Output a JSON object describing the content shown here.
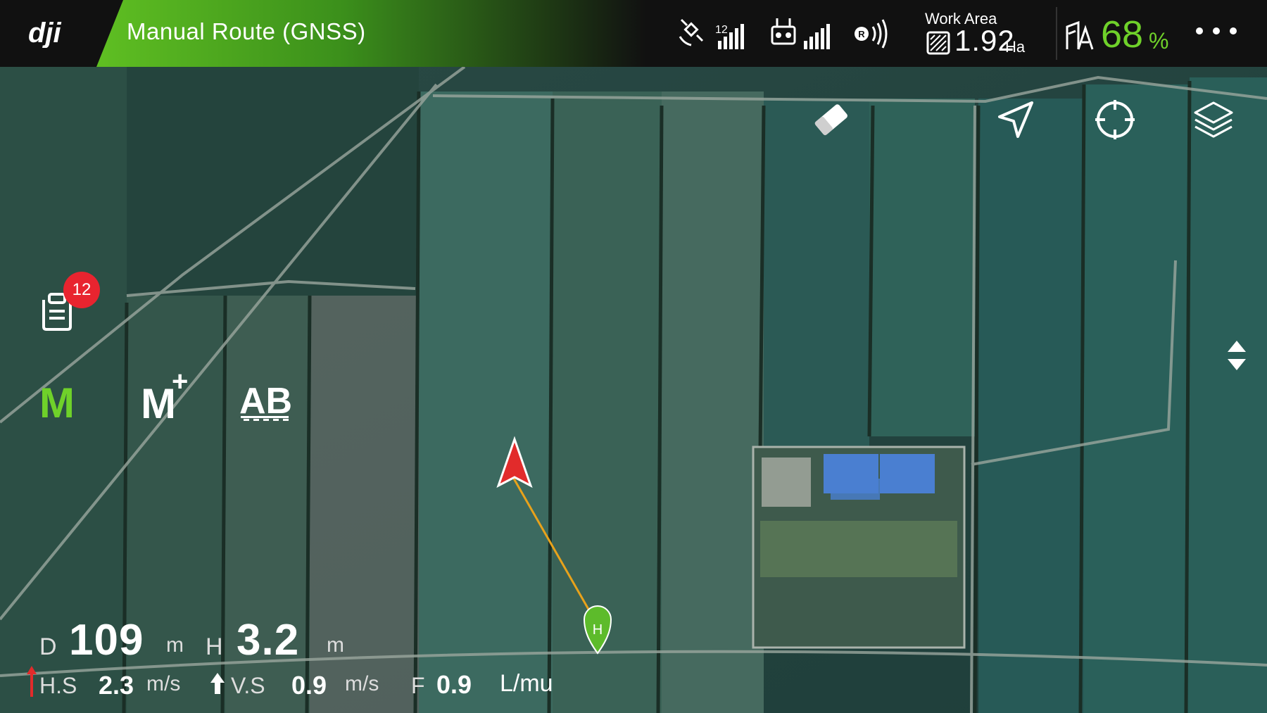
{
  "header": {
    "mode_title": "Manual Route (GNSS)",
    "gnss_count": "12",
    "work_area": {
      "label": "Work Area",
      "value": "1.92",
      "unit": "Ha"
    },
    "battery": {
      "value": "68",
      "unit": "%"
    },
    "colors": {
      "accent": "#6fd12a",
      "banner": "#5fbf22",
      "badge": "#e8242f"
    }
  },
  "left_panel": {
    "task_badge": "12",
    "modes": {
      "m": "M",
      "m_plus": "M",
      "m_plus_sup": "+",
      "ab": "AB"
    }
  },
  "map": {
    "home_point_label": "H"
  },
  "telemetry": {
    "distance": {
      "label": "D",
      "value": "109",
      "unit": "m"
    },
    "height": {
      "label": "H",
      "value": "3.2",
      "unit": "m"
    },
    "h_speed": {
      "label": "H.S",
      "value": "2.3",
      "unit": "m/s"
    },
    "v_speed": {
      "label": "V.S",
      "value": "0.9",
      "unit": "m/s"
    },
    "flow": {
      "label": "F",
      "value": "0.9",
      "unit": "L/mu"
    }
  },
  "icons": [
    "dji-logo",
    "gnss-satellite-icon",
    "rc-signal-icon",
    "rtk-icon",
    "work-area-icon",
    "battery-icon",
    "more-icon",
    "eraser-icon",
    "compass-icon",
    "locate-arrow-icon",
    "crosshair-icon",
    "layers-icon",
    "expand-toggle-icon",
    "task-list-icon",
    "aircraft-icon",
    "home-point-icon"
  ]
}
